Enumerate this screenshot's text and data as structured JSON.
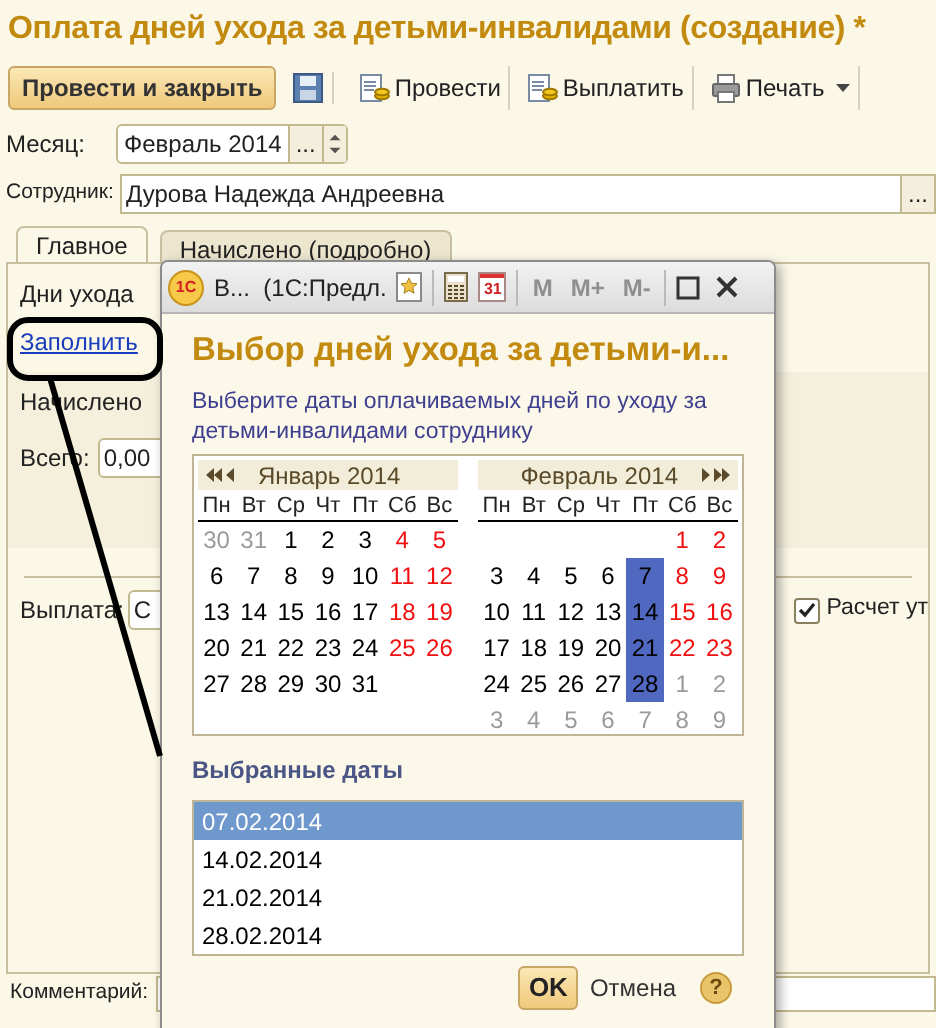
{
  "window": {
    "title": "Оплата дней ухода за детьми-инвалидами (создание) *"
  },
  "toolbar": [
    {
      "kind": "primary",
      "label": "Провести и закрыть"
    },
    {
      "kind": "save"
    },
    {
      "kind": "post",
      "label": "Провести"
    },
    {
      "kind": "pay",
      "label": "Выплатить"
    },
    {
      "kind": "print",
      "label": "Печать"
    }
  ],
  "month": {
    "label": "Месяц:",
    "value": "Февраль 2014",
    "button": "..."
  },
  "employee": {
    "label": "Сотрудник:",
    "value": "Дурова Надежда Андреевна",
    "button": "..."
  },
  "tabs": [
    {
      "label": "Главное",
      "selected": true
    },
    {
      "label": "Начислено (подробно)",
      "selected": false
    }
  ],
  "main": {
    "care_days": "Дни ухода",
    "fill_link": "Заполнить",
    "accrued": "Начислено",
    "total_label": "Всего:",
    "total_value": "0,00",
    "payment_label": "Выплата:",
    "payment_value": "С",
    "calc_label": "Расчет ут",
    "calc_checked": true,
    "comment_label": "Комментарий:"
  },
  "dialog": {
    "logo_text": "1С",
    "title": "В...  (1С:Предл.",
    "calendar_icon_text": "31",
    "memory_buttons": [
      {
        "label": "M",
        "disabled": true
      },
      {
        "label": "M+",
        "disabled": true
      },
      {
        "label": "M-",
        "disabled": true
      }
    ],
    "heading": "Выбор дней ухода за детьми-и...",
    "description": "Выберите даты оплачиваемых дней по уходу за детьми-инвалидами сотруднику",
    "months": [
      {
        "title": "Январь 2014",
        "kind": "prev",
        "weekdays": [
          "Пн",
          "Вт",
          "Ср",
          "Чт",
          "Пт",
          "Сб",
          "Вс"
        ],
        "weeks": [
          [
            {
              "d": "30",
              "kind": "other",
              "selected": false
            },
            {
              "d": "31",
              "kind": "other",
              "selected": false
            },
            {
              "d": "1",
              "kind": "work",
              "selected": false
            },
            {
              "d": "2",
              "kind": "work",
              "selected": false
            },
            {
              "d": "3",
              "kind": "work",
              "selected": false
            },
            {
              "d": "4",
              "kind": "holiday",
              "selected": false
            },
            {
              "d": "5",
              "kind": "holiday",
              "selected": false
            }
          ],
          [
            {
              "d": "6",
              "kind": "work",
              "selected": false
            },
            {
              "d": "7",
              "kind": "work",
              "selected": false
            },
            {
              "d": "8",
              "kind": "work",
              "selected": false
            },
            {
              "d": "9",
              "kind": "work",
              "selected": false
            },
            {
              "d": "10",
              "kind": "work",
              "selected": false
            },
            {
              "d": "11",
              "kind": "holiday",
              "selected": false
            },
            {
              "d": "12",
              "kind": "holiday",
              "selected": false
            }
          ],
          [
            {
              "d": "13",
              "kind": "work",
              "selected": false
            },
            {
              "d": "14",
              "kind": "work",
              "selected": false
            },
            {
              "d": "15",
              "kind": "work",
              "selected": false
            },
            {
              "d": "16",
              "kind": "work",
              "selected": false
            },
            {
              "d": "17",
              "kind": "work",
              "selected": false
            },
            {
              "d": "18",
              "kind": "holiday",
              "selected": false
            },
            {
              "d": "19",
              "kind": "holiday",
              "selected": false
            }
          ],
          [
            {
              "d": "20",
              "kind": "work",
              "selected": false
            },
            {
              "d": "21",
              "kind": "work",
              "selected": false
            },
            {
              "d": "22",
              "kind": "work",
              "selected": false
            },
            {
              "d": "23",
              "kind": "work",
              "selected": false
            },
            {
              "d": "24",
              "kind": "work",
              "selected": false
            },
            {
              "d": "25",
              "kind": "holiday",
              "selected": false
            },
            {
              "d": "26",
              "kind": "holiday",
              "selected": false
            }
          ],
          [
            {
              "d": "27",
              "kind": "work",
              "selected": false
            },
            {
              "d": "28",
              "kind": "work",
              "selected": false
            },
            {
              "d": "29",
              "kind": "work",
              "selected": false
            },
            {
              "d": "30",
              "kind": "work",
              "selected": false
            },
            {
              "d": "31",
              "kind": "work",
              "selected": false
            }
          ]
        ]
      },
      {
        "title": "Февраль 2014",
        "kind": "next",
        "weekdays": [
          "Пн",
          "Вт",
          "Ср",
          "Чт",
          "Пт",
          "Сб",
          "Вс"
        ],
        "weeks": [
          [
            {
              "d": "1",
              "kind": "holiday",
              "selected": false
            },
            {
              "d": "2",
              "kind": "holiday",
              "selected": false
            }
          ],
          [
            {
              "d": "3",
              "kind": "work",
              "selected": false
            },
            {
              "d": "4",
              "kind": "work",
              "selected": false
            },
            {
              "d": "5",
              "kind": "work",
              "selected": false
            },
            {
              "d": "6",
              "kind": "work",
              "selected": false
            },
            {
              "d": "7",
              "kind": "work",
              "selected": true
            },
            {
              "d": "8",
              "kind": "holiday",
              "selected": false
            },
            {
              "d": "9",
              "kind": "holiday",
              "selected": false
            }
          ],
          [
            {
              "d": "10",
              "kind": "work",
              "selected": false
            },
            {
              "d": "11",
              "kind": "work",
              "selected": false
            },
            {
              "d": "12",
              "kind": "work",
              "selected": false
            },
            {
              "d": "13",
              "kind": "work",
              "selected": false
            },
            {
              "d": "14",
              "kind": "work",
              "selected": true
            },
            {
              "d": "15",
              "kind": "holiday",
              "selected": false
            },
            {
              "d": "16",
              "kind": "holiday",
              "selected": false
            }
          ],
          [
            {
              "d": "17",
              "kind": "work",
              "selected": false
            },
            {
              "d": "18",
              "kind": "work",
              "selected": false
            },
            {
              "d": "19",
              "kind": "work",
              "selected": false
            },
            {
              "d": "20",
              "kind": "work",
              "selected": false
            },
            {
              "d": "21",
              "kind": "work",
              "selected": true
            },
            {
              "d": "22",
              "kind": "holiday",
              "selected": false
            },
            {
              "d": "23",
              "kind": "holiday",
              "selected": false
            }
          ],
          [
            {
              "d": "24",
              "kind": "work",
              "selected": false
            },
            {
              "d": "25",
              "kind": "work",
              "selected": false
            },
            {
              "d": "26",
              "kind": "work",
              "selected": false
            },
            {
              "d": "27",
              "kind": "work",
              "selected": false
            },
            {
              "d": "28",
              "kind": "work",
              "selected": true
            },
            {
              "d": "1",
              "kind": "other",
              "selected": false
            },
            {
              "d": "2",
              "kind": "other",
              "selected": false
            }
          ],
          [
            {
              "d": "3",
              "kind": "other",
              "selected": false
            },
            {
              "d": "4",
              "kind": "other",
              "selected": false
            },
            {
              "d": "5",
              "kind": "other",
              "selected": false
            },
            {
              "d": "6",
              "kind": "other",
              "selected": false
            },
            {
              "d": "7",
              "kind": "other",
              "selected": false
            },
            {
              "d": "8",
              "kind": "other",
              "selected": false
            },
            {
              "d": "9",
              "kind": "other",
              "selected": false
            }
          ]
        ]
      }
    ],
    "selected_heading": "Выбранные даты",
    "selected_dates": [
      {
        "label": "07.02.2014",
        "selected": true
      },
      {
        "label": "14.02.2014",
        "selected": false
      },
      {
        "label": "21.02.2014",
        "selected": false
      },
      {
        "label": "28.02.2014",
        "selected": false
      }
    ],
    "ok": "OK",
    "cancel": "Отмена",
    "help_glyph": "?"
  }
}
